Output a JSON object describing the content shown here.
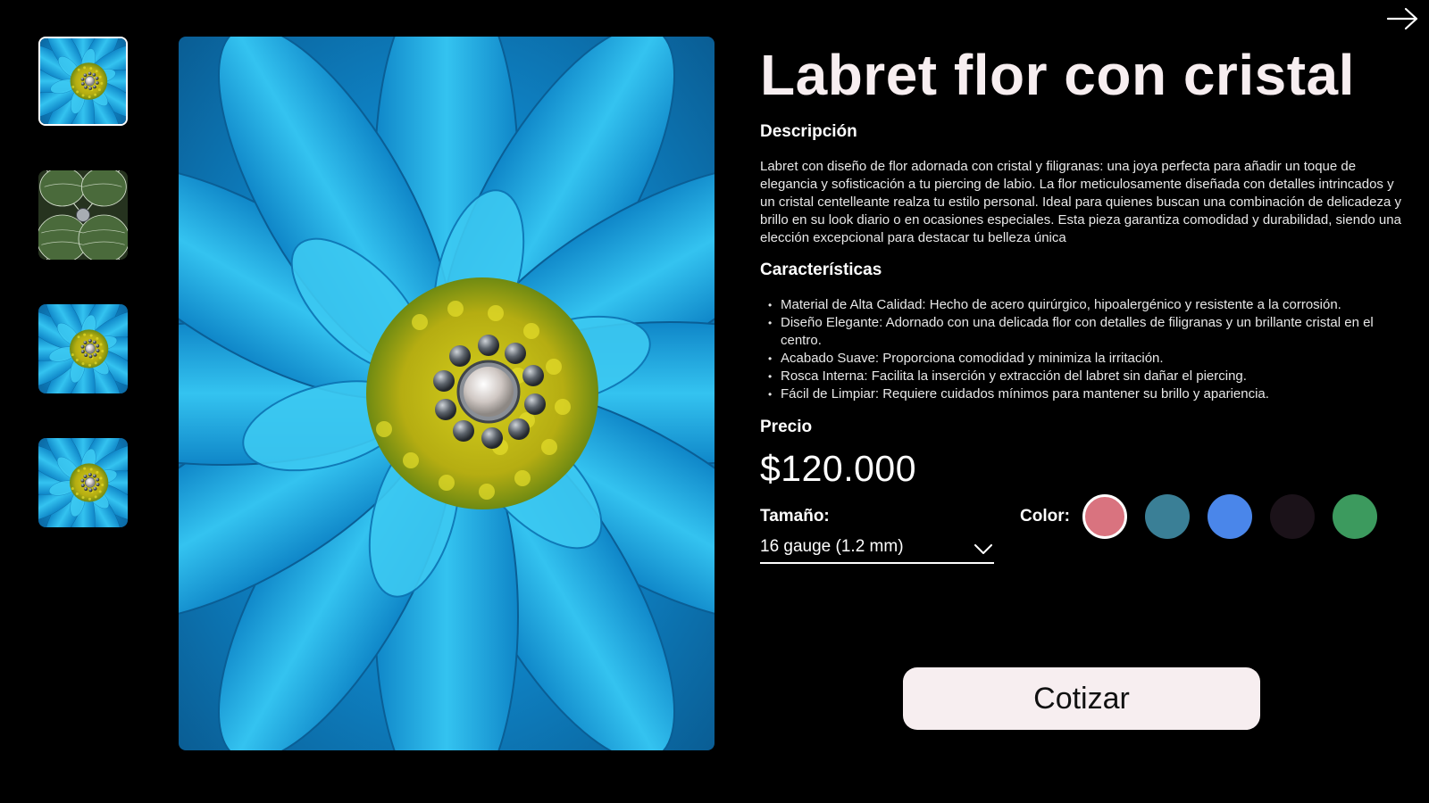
{
  "navigation": {
    "next_icon": "arrow-right-icon"
  },
  "gallery": {
    "thumbnails": [
      {
        "alt": "blue-flower-thumbnail",
        "selected": true
      },
      {
        "alt": "plant-leaves-thumbnail",
        "selected": false
      },
      {
        "alt": "blue-flower-thumbnail",
        "selected": false
      },
      {
        "alt": "blue-flower-thumbnail",
        "selected": false
      }
    ],
    "main_image": "blue-flower-with-labret"
  },
  "product": {
    "title": "Labret flor con cristal",
    "description_heading": "Descripción",
    "description": "Labret con diseño de flor adornada con cristal y filigranas: una joya perfecta para añadir un toque de elegancia y sofisticación a tu piercing de labio. La flor meticulosamente diseñada con detalles intrincados y un cristal centelleante realza tu estilo personal. Ideal para quienes buscan una combinación de delicadeza y brillo en su look diario o en ocasiones especiales. Esta pieza garantiza comodidad y durabilidad, siendo una elección excepcional para destacar tu belleza única",
    "features_heading": "Características",
    "features": [
      "Material de Alta Calidad: Hecho de acero quirúrgico, hipoalergénico y resistente a la corrosión.",
      "Diseño Elegante: Adornado con una delicada flor con detalles de filigranas y un brillante cristal en el centro.",
      "Acabado Suave: Proporciona comodidad y minimiza la irritación.",
      "Rosca Interna: Facilita la inserción y extracción del labret sin dañar el piercing.",
      "Fácil de Limpiar: Requiere cuidados mínimos para mantener su brillo y apariencia."
    ],
    "price_heading": "Precio",
    "price": "$120.000",
    "size_label": "Tamaño:",
    "size_value": "16 gauge (1.2 mm)",
    "size_icon": "chevron-down-icon",
    "color_label": "Color:",
    "colors": [
      {
        "hex": "#d9737f",
        "selected": true
      },
      {
        "hex": "#3a7f96",
        "selected": false
      },
      {
        "hex": "#4a86ea",
        "selected": false
      },
      {
        "hex": "#1b1219",
        "selected": false
      },
      {
        "hex": "#3c9a5e",
        "selected": false
      }
    ],
    "cta_label": "Cotizar"
  },
  "theme": {
    "background": "#000000",
    "title_color": "#f7eef0",
    "button_bg": "#f7eef0"
  }
}
